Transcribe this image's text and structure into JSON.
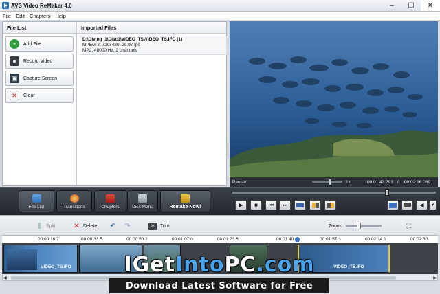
{
  "window": {
    "title": "AVS Video ReMaker 4.0",
    "minimize": "–",
    "maximize": "☐",
    "close": "✕"
  },
  "menu": [
    "File",
    "Edit",
    "Chapters",
    "Help"
  ],
  "file_list": {
    "heading": "File List",
    "buttons": [
      {
        "label": "Add File",
        "icon": "add-icon"
      },
      {
        "label": "Record Video",
        "icon": "record-video-icon"
      },
      {
        "label": "Capture Screen",
        "icon": "capture-screen-icon"
      },
      {
        "label": "Clear",
        "icon": "clear-icon"
      }
    ]
  },
  "imported_files": {
    "heading": "Imported Files",
    "items": [
      {
        "path": "D:\\Diving_1\\Disc1\\VIDEO_TS\\VIDEO_TS.IFO (1)",
        "video": "MPEG-2, 720x480, 29.97 fps",
        "audio": "MP2, 48000 Hz, 2 channels"
      }
    ]
  },
  "preview": {
    "state": "Paused",
    "zoom": "1x",
    "current_time": "00:01:43.793",
    "separator": "/",
    "total_time": "00:02:16.069",
    "seek_position": 0.76
  },
  "main_toolbar": {
    "tabs": [
      {
        "label": "File List",
        "icon": "file-list-icon"
      },
      {
        "label": "Transitions",
        "icon": "transitions-icon"
      },
      {
        "label": "Chapters",
        "icon": "chapters-icon"
      },
      {
        "label": "Disc Menu",
        "icon": "disc-menu-icon"
      }
    ],
    "remake_label": "Remake Now!"
  },
  "playback": {
    "play": "▶",
    "stop": "■",
    "prev": "⏮",
    "next": "⏭"
  },
  "timeline": {
    "split_label": "Split",
    "delete_label": "Delete",
    "trim_label": "Trim",
    "zoom_label": "Zoom:",
    "ticks": [
      "00:00:16.7",
      "00:00:33.5",
      "00:00:50.2",
      "00:01:07.0",
      "00:01:23.8",
      "00:01:40",
      "00:01:57.3",
      "00:02:14.1",
      "00:02:30"
    ],
    "clips": [
      {
        "label": "VIDEO_TS.IFO"
      },
      {
        "label": ""
      },
      {
        "label": ""
      },
      {
        "label": ""
      },
      {
        "label": "VIDEO_TS.IFO"
      }
    ]
  },
  "watermark": {
    "main_a": "I",
    "main_b": "Get",
    "main_c": "Into",
    "main_d": "PC",
    "main_e": ".com",
    "subtitle": "Download Latest Software for Free"
  }
}
